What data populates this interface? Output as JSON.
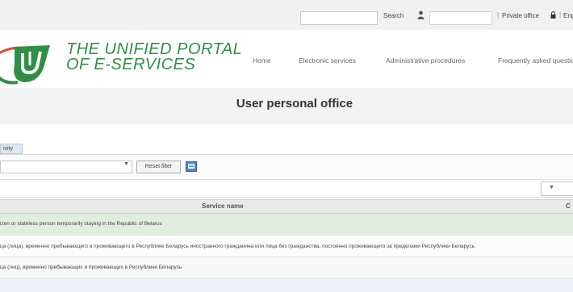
{
  "topbar": {
    "search_label": "Search",
    "separator": "|",
    "private_office_label": "Private office",
    "lang_label": "Eng"
  },
  "header": {
    "portal_title_line1": "THE UNIFIED PORTAL",
    "portal_title_line2": "OF E-SERVICES",
    "nav": [
      {
        "label": "Home"
      },
      {
        "label": "Electronic services"
      },
      {
        "label": "Administrative procedures"
      },
      {
        "label": "Frequently asked questions"
      }
    ]
  },
  "page_title": "User personal office",
  "filters": {
    "tab_label": "ivity",
    "select_value": "",
    "reset_label": "Reset filter"
  },
  "table": {
    "columns": [
      "Service name",
      "C"
    ],
    "rows": [
      {
        "service": "izen or stateless person temporarily staying in the Republic of Belarus",
        "highlighted": true
      },
      {
        "service": "ца (лица), временно пребывающего и проживающего в Республике Беларусь иностранного гражданина или лица без гражданства, постоянно проживающего за пределами Республики Беларусь",
        "highlighted": false
      },
      {
        "service": "ца (лиц), временно пребывающих и проживающих в Республике Беларусь",
        "highlighted": false
      }
    ]
  },
  "colors": {
    "brand_green": "#2f8f46",
    "row_highlight": "#dfeedd",
    "export_icon_blue": "#4f86c6"
  }
}
